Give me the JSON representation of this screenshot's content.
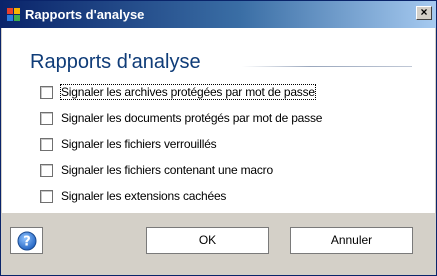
{
  "window": {
    "title": "Rapports d'analyse",
    "close_glyph": "×"
  },
  "heading": "Rapports d'analyse",
  "options": [
    {
      "label": "Signaler les archives protégées par mot de passe",
      "checked": false
    },
    {
      "label": "Signaler les documents protégés par mot de passe",
      "checked": false
    },
    {
      "label": "Signaler les fichiers verrouillés",
      "checked": false
    },
    {
      "label": "Signaler les fichiers contenant une macro",
      "checked": false
    },
    {
      "label": "Signaler les extensions cachées",
      "checked": false
    }
  ],
  "buttons": {
    "help_icon": "help-icon",
    "ok": "OK",
    "cancel": "Annuler"
  },
  "colors": {
    "titlebar": "#0a246a",
    "heading": "#0f3c78",
    "footer": "#d4d0c8"
  }
}
